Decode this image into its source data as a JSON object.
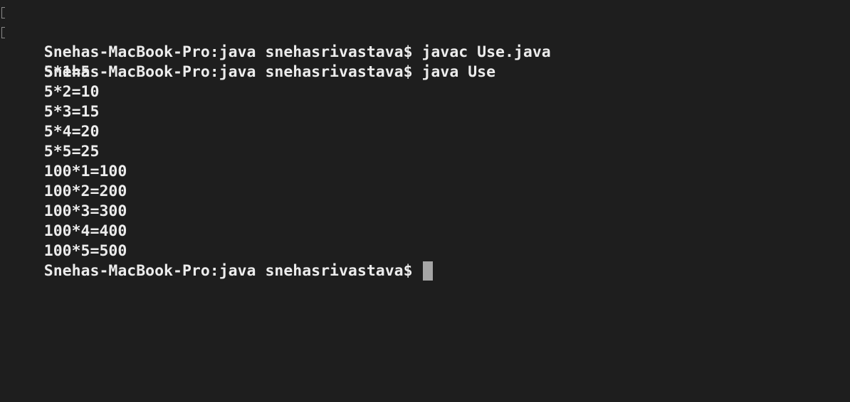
{
  "terminal": {
    "lines": [
      {
        "text": "Snehas-MacBook-Pro:java snehasrivastava$ javac Use.java",
        "marked": true
      },
      {
        "text": "Snehas-MacBook-Pro:java snehasrivastava$ java Use",
        "marked": true
      },
      {
        "text": "5*1=5"
      },
      {
        "text": "5*2=10"
      },
      {
        "text": "5*3=15"
      },
      {
        "text": "5*4=20"
      },
      {
        "text": "5*5=25"
      },
      {
        "text": "100*1=100"
      },
      {
        "text": "100*2=200"
      },
      {
        "text": "100*3=300"
      },
      {
        "text": "100*4=400"
      },
      {
        "text": "100*5=500"
      }
    ],
    "prompt": "Snehas-MacBook-Pro:java snehasrivastava$ ",
    "background_color": "#1e1e1e",
    "text_color": "#ececec",
    "cursor_color": "#a6a6a6"
  }
}
